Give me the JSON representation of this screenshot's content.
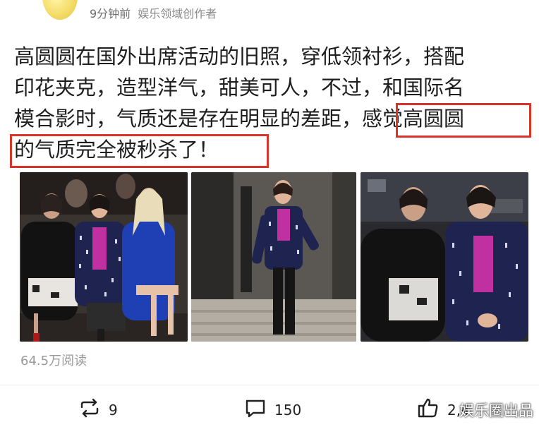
{
  "header": {
    "time_ago": "9分钟前",
    "author_tag": "娱乐领域创作者"
  },
  "post": {
    "lines": [
      "高圆圆在国外出席活动的旧照，穿低领衬衫，搭配",
      "印花夹克，造型洋气，甜美可人，不过，和国际名",
      "模合影时，气质还是存在明显的差距，感觉高圆圆",
      "的气质完全被秒杀了！"
    ]
  },
  "stats": {
    "reads": "64.5万阅读"
  },
  "actions": {
    "repost_count": "9",
    "comment_count": "150",
    "like_count": "2,4"
  },
  "watermark": "娱乐圈出品",
  "colors": {
    "highlight_border": "#d9342b",
    "jacket_navy": "#1f2350",
    "blouse_magenta": "#c030a0"
  },
  "icons": [
    "repost-icon",
    "comment-icon",
    "like-icon"
  ]
}
